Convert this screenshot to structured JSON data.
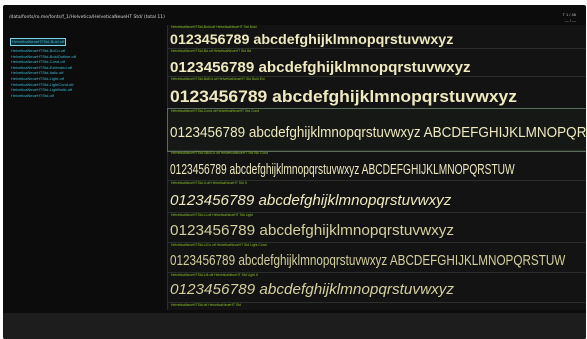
{
  "window": {
    "title": "/data/fonts/ro.me/fonts/f_1/Helvetica/HelveticaNeueHT Std/ (total 11)",
    "corner_top": "T 1 / 46",
    "corner_bottom": "— / —"
  },
  "files": [
    "HelveticaNeueHTStd-Bold.otf",
    "HelveticaNeueHTStd-BdCn.otf",
    "HelveticaNeueHTStd-BoldOutline.otf",
    "HelveticaNeueHTStd-Cond.otf",
    "HelveticaNeueHTStd-Extended.otf",
    "HelveticaNeueHTStd-Italic.otf",
    "HelveticaNeueHTStd-Light.otf",
    "HelveticaNeueHTStd-LightCond.otf",
    "HelveticaNeueHTStd-LightItalic.otf",
    "HelveticaNeueHTStd.otf"
  ],
  "samples": [
    {
      "meta": "HelveticaNeueHTStd-Bold.otf   HelveticaNeueHT Std Bold",
      "text": "0123456789 abcdefghijklmnopqrstuvwxyz"
    },
    {
      "meta": "HelveticaNeueHTStd-Bd.otf   HelveticaNeueHT Std Bd",
      "text": "0123456789 abcdefghijklmnopqrstuvwxyz"
    },
    {
      "meta": "HelveticaNeueHTStd-BdExt.otf   HelveticaNeueHT Std Bold Ext",
      "text": "0123456789 abcdefghijklmnopqrstuvwxyz"
    },
    {
      "meta": "HelveticaNeueHTStd-Cond.otf   HelveticaNeueHT Std Cond",
      "text": "0123456789 abcdefghijklmnopqrstuvwxyz ABCDEFGHIJKLMNOPQRSTUW"
    },
    {
      "meta": "HelveticaNeueHTStd-XBlkCn.otf   HelveticaNeueHT Std Blk Cond",
      "text": "0123456789 abcdefghijklmnopqrstuvwxyz ABCDEFGHIJKLMNOPQRSTUW"
    },
    {
      "meta": "HelveticaNeueHTStd-It.otf   HelveticaNeueHT Std It",
      "text": "0123456789 abcdefghijklmnopqrstuvwxyz"
    },
    {
      "meta": "HelveticaNeueHTStd-Lt.otf   HelveticaNeueHT Std Light",
      "text": "0123456789 abcdefghijklmnopqrstuvwxyz"
    },
    {
      "meta": "HelveticaNeueHTStd-LtCn.otf   HelveticaNeueHT Std Light Cond",
      "text": "0123456789 abcdefghijklmnopqrstuvwxyz ABCDEFGHIJKLMNOPQRSTUW"
    },
    {
      "meta": "HelveticaNeueHTStd-LtIt.otf   HelveticaNeueHT Std Light It",
      "text": "0123456789 abcdefghijklmnopqrstuvwxyz"
    },
    {
      "meta": "HelveticaNeueHTStd.otf   HelveticaNeueHT Std",
      "text": ""
    }
  ],
  "colors": {
    "background": "#0c0c0c",
    "file_link": "#3bb8d4",
    "meta_text": "#8ebf2a",
    "sample_text": "#eee9bf"
  }
}
